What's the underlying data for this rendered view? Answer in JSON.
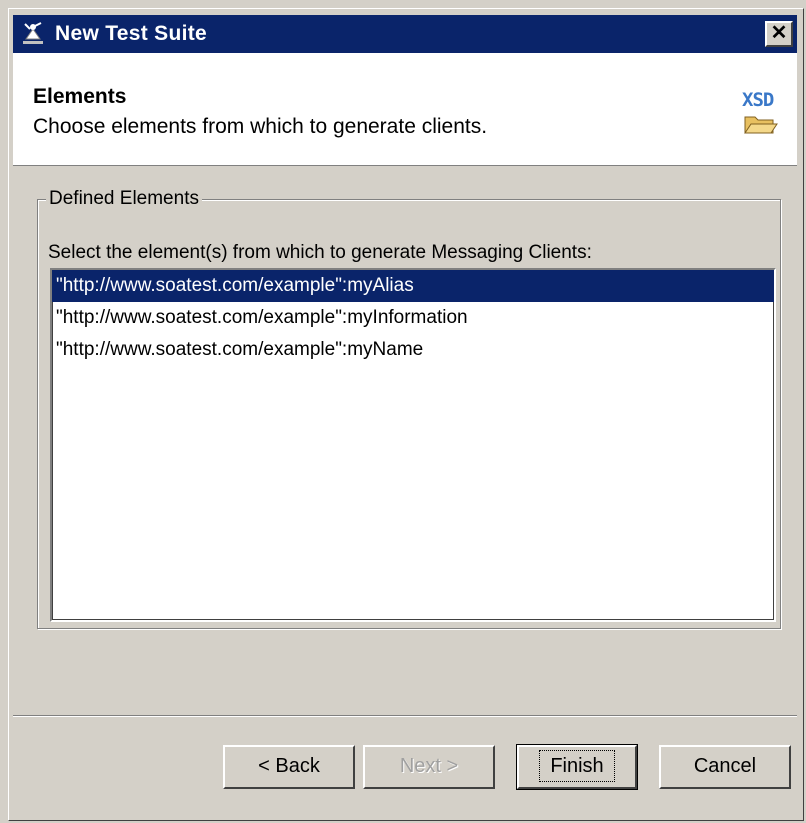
{
  "window": {
    "title": "New Test Suite",
    "close_glyph": "✕"
  },
  "header": {
    "title": "Elements",
    "description": "Choose elements from which to generate clients.",
    "icon_text": "XSD"
  },
  "group": {
    "legend": "Defined Elements",
    "description": "Select the element(s) from which to generate Messaging Clients:",
    "items": [
      {
        "label": "\"http://www.soatest.com/example\":myAlias",
        "selected": true
      },
      {
        "label": "\"http://www.soatest.com/example\":myInformation",
        "selected": false
      },
      {
        "label": "\"http://www.soatest.com/example\":myName",
        "selected": false
      }
    ]
  },
  "buttons": {
    "back": "< Back",
    "next": "Next >",
    "finish": "Finish",
    "cancel": "Cancel"
  },
  "colors": {
    "titlebar": "#0a246a",
    "selection": "#0a246a",
    "dialog_bg": "#d4d0c8",
    "xsd_blue": "#3a78c8"
  }
}
